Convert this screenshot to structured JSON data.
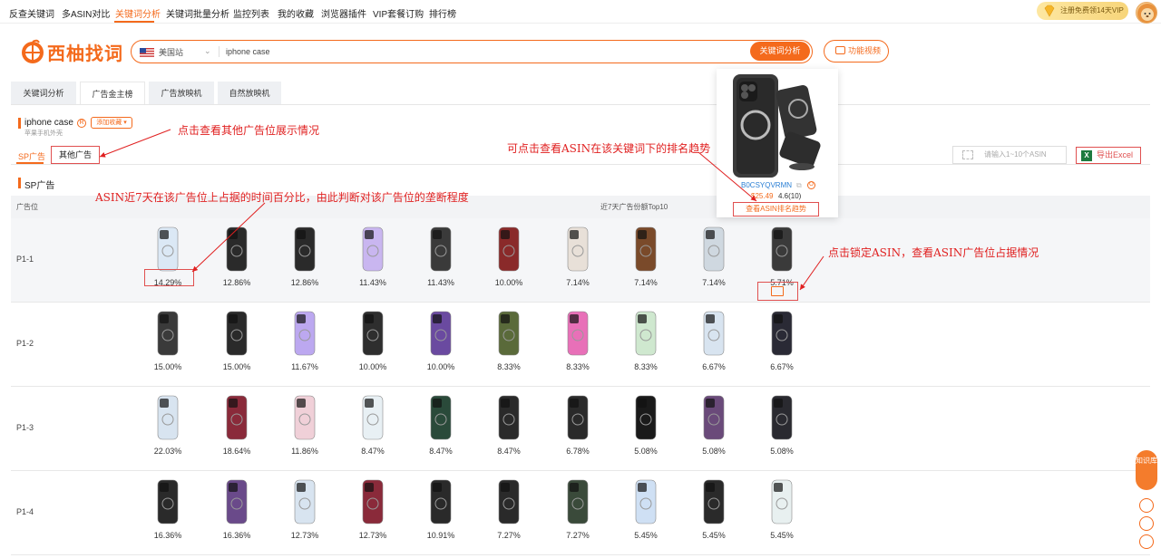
{
  "topnav": {
    "items": [
      "反查关键词",
      "多ASIN对比",
      "关键词分析",
      "关键词批量分析",
      "监控列表",
      "我的收藏",
      "浏览器插件",
      "VIP套餐订购",
      "排行榜"
    ],
    "vip_label": "注册免费领14天VIP"
  },
  "brand": {
    "name": "西柚找词",
    "color": "#f46a1c"
  },
  "search": {
    "site": "美国站",
    "value": "iphone case",
    "button": "关键词分析"
  },
  "video_button": "功能视频",
  "tabs": [
    "关键词分析",
    "广告金主榜",
    "广告放映机",
    "自然放映机"
  ],
  "keyword": {
    "title": "iphone case",
    "mark": "R",
    "fav": "添加收藏 ▾",
    "subtitle": "苹果手机外壳"
  },
  "subtabs": {
    "sp": "SP广告",
    "other": "其他广告"
  },
  "asin_input_placeholder": "请输入1~10个ASIN",
  "excel_label": "导出Excel",
  "section_title": "SP广告",
  "table": {
    "col_position": "广告位",
    "col_top10": "近7天广告份额Top10",
    "rows": [
      {
        "pos": "P1-1",
        "pcts": [
          "14.29%",
          "12.86%",
          "12.86%",
          "11.43%",
          "11.43%",
          "10.00%",
          "7.14%",
          "7.14%",
          "7.14%",
          "5.71%"
        ]
      },
      {
        "pos": "P1-2",
        "pcts": [
          "15.00%",
          "15.00%",
          "11.67%",
          "10.00%",
          "10.00%",
          "8.33%",
          "8.33%",
          "8.33%",
          "6.67%",
          "6.67%"
        ]
      },
      {
        "pos": "P1-3",
        "pcts": [
          "22.03%",
          "18.64%",
          "11.86%",
          "8.47%",
          "8.47%",
          "8.47%",
          "6.78%",
          "5.08%",
          "5.08%",
          "5.08%"
        ]
      },
      {
        "pos": "P1-4",
        "pcts": [
          "16.36%",
          "16.36%",
          "12.73%",
          "12.73%",
          "10.91%",
          "7.27%",
          "7.27%",
          "5.45%",
          "5.45%",
          "5.45%"
        ]
      }
    ]
  },
  "popup": {
    "asin": "B0CSYQVRMN",
    "o_mark": "O",
    "price": "$25.49",
    "rating": "4.6(10)",
    "trend_button": "查看ASIN排名趋势"
  },
  "annotations": {
    "other_ads": "点击查看其他广告位展示情况",
    "rank_trend": "可点击查看ASIN在该关键词下的排名趋势",
    "share": "ASIN近7天在该广告位上占据的时间百分比，由此判断对该广告位的垄断程度",
    "lock": "点击锁定ASIN，查看ASIN广告位占据情况"
  },
  "side": {
    "knowledge": "知识库"
  }
}
